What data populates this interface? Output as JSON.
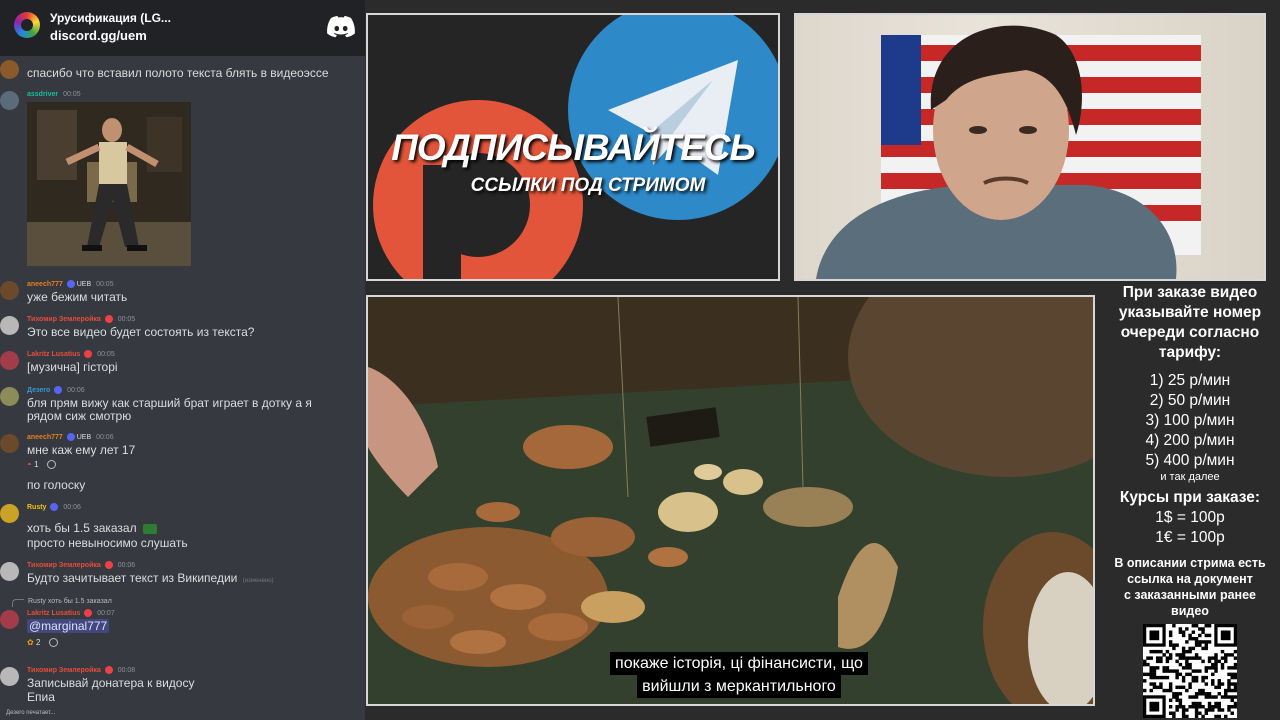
{
  "discord": {
    "server_name": "Урусификация (LG...",
    "invite": "discord.gg/uem",
    "icons": [
      "discord-logo-icon"
    ],
    "messages": [
      {
        "text": "спасибо что вставил полото текста блять в видеоэссе"
      },
      {
        "user": "assdriver",
        "time": "00:05",
        "user_color": "#1abc9c",
        "attachment": "dancing-man-gif"
      },
      {
        "user": "aneech777",
        "badge": "UEB",
        "time": "00:05",
        "user_color": "#e67e22",
        "text": "уже бежим читать"
      },
      {
        "user": "Тихомир Землеройка",
        "time": "00:05",
        "user_color": "#e74c3c",
        "text": "Это все видео будет состоять из текста?"
      },
      {
        "user": "Lakritz Lusatius",
        "time": "00:05",
        "user_color": "#e74c3c",
        "text": "[музична] гісторі"
      },
      {
        "user": "Дезеrо",
        "time": "00:06",
        "user_color": "#3498db",
        "text": "бля прям вижу как старший брат играет в дотку а я",
        "text2": "рядом сиж смотрю"
      },
      {
        "user": "aneech777",
        "badge": "UEB",
        "time": "00:06",
        "user_color": "#e67e22",
        "text": "мне каж ему лет 17",
        "reaction_count": "1",
        "text2": "по голоску"
      },
      {
        "user": "Rusty",
        "time": "00:06",
        "user_color": "#f1c40f",
        "text": "хоть бы 1.5 заказал",
        "text2": "просто невыносимо слушать"
      },
      {
        "user": "Тихомир Землеройка",
        "time": "00:06",
        "user_color": "#e74c3c",
        "text": "Будто зачитывает текст из Википедии",
        "edited": "(изменено)"
      },
      {
        "reply_preview": "Rusty хоть бы 1.5 заказал",
        "user": "Lakritz Lusatius",
        "time": "00:07",
        "user_color": "#e74c3c",
        "mention": "@marginal777",
        "reaction_count": "2"
      },
      {
        "user": "Тихомир Землеройка",
        "time": "00:08",
        "user_color": "#e74c3c",
        "text": "Записывай донатера к видосу",
        "text2": "Епиа"
      }
    ],
    "typing": "Дезеrо печатает..."
  },
  "banner": {
    "title": "ПОДПИСЫВАЙТЕСЬ",
    "subtitle": "ССЫЛКИ ПОД СТРИМОМ",
    "icons": [
      "patreon-logo-icon",
      "telegram-logo-icon"
    ],
    "colors": {
      "patreon": "#e2553a",
      "telegram": "#2d89c8"
    }
  },
  "video": {
    "subtitle_line1": "покаже історія, ці фінансисти, що",
    "subtitle_line2": "вийшли з меркантильного"
  },
  "info": {
    "heading": [
      "При заказе видео",
      "указывайте номер",
      "очереди согласно",
      "тарифу:"
    ],
    "tariffs": [
      "1) 25 р/мин",
      "2) 50 р/мин",
      "3) 100 р/мин",
      "4) 200 р/мин",
      "5) 400 р/мин"
    ],
    "and_so_on": "и так далее",
    "courses_title": "Курсы при заказе:",
    "courses": [
      "1$ = 100р",
      "1€ = 100р"
    ],
    "note": [
      "В описании стрима есть",
      "ссылка на документ",
      "с заказанными ранее",
      "видео"
    ]
  }
}
